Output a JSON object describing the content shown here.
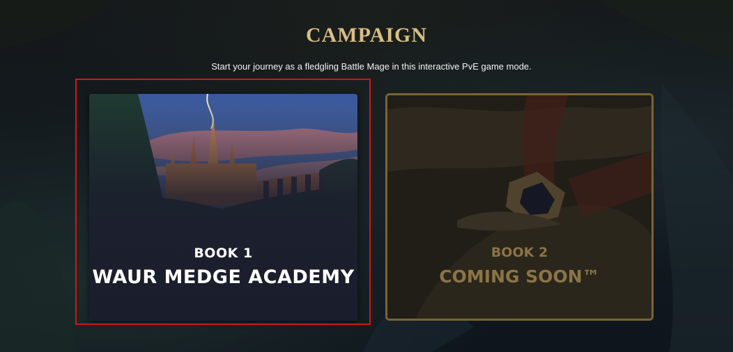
{
  "page": {
    "title": "CAMPAIGN",
    "subtitle": "Start your journey as a fledgling Battle Mage in this interactive PvE game mode."
  },
  "cards": [
    {
      "book_label": "BOOK 1",
      "name": "WAUR MEDGE ACADEMY",
      "state": "available"
    },
    {
      "book_label": "BOOK 2",
      "name": "COMING SOON™",
      "state": "locked"
    }
  ],
  "colors": {
    "title_gold": "#d8bd84",
    "locked_gold": "#8b7446",
    "selection_red": "#e01010",
    "background": "#111820"
  }
}
